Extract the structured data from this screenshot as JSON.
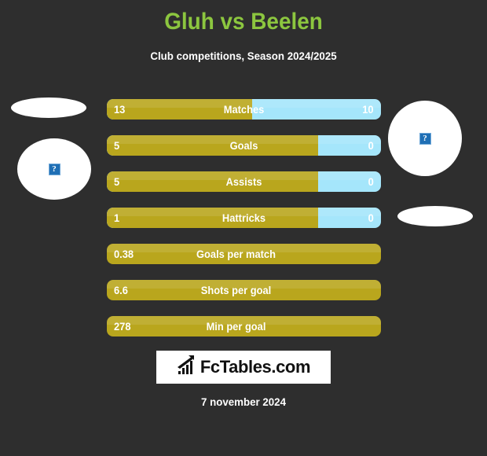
{
  "header": {
    "title": "Gluh vs Beelen",
    "subtitle": "Club competitions, Season 2024/2025",
    "title_color": "#8cc63f"
  },
  "placeholders": {
    "broken_image_glyph": "?",
    "left_top_name": "broken-image-ellipse",
    "left_bottom_name": "broken-image-circle",
    "right_top_name": "broken-image-circle",
    "right_bottom_name": "broken-image-ellipse"
  },
  "colors": {
    "background": "#2e2e2e",
    "home": "#b9a61d",
    "away": "#a5e6fb",
    "accent": "#8cc63f",
    "text": "#ffffff"
  },
  "chart_data": {
    "type": "bar",
    "title": "Gluh vs Beelen",
    "subtitle": "Club competitions, Season 2024/2025",
    "orientation": "horizontal-diverging",
    "series": [
      {
        "name": "Gluh",
        "color": "#b9a61d"
      },
      {
        "name": "Beelen",
        "color": "#a5e6fb"
      }
    ],
    "categories": [
      "Matches",
      "Goals",
      "Assists",
      "Hattricks",
      "Goals per match",
      "Shots per goal",
      "Min per goal"
    ],
    "rows": [
      {
        "label": "Matches",
        "left": "13",
        "right": "10",
        "left_pct": 53,
        "two_sided": true
      },
      {
        "label": "Goals",
        "left": "5",
        "right": "0",
        "left_pct": 77,
        "two_sided": true
      },
      {
        "label": "Assists",
        "left": "5",
        "right": "0",
        "left_pct": 77,
        "two_sided": true
      },
      {
        "label": "Hattricks",
        "left": "1",
        "right": "0",
        "left_pct": 77,
        "two_sided": true
      },
      {
        "label": "Goals per match",
        "left": "0.38",
        "right": "",
        "left_pct": 100,
        "two_sided": false
      },
      {
        "label": "Shots per goal",
        "left": "6.6",
        "right": "",
        "left_pct": 100,
        "two_sided": false
      },
      {
        "label": "Min per goal",
        "left": "278",
        "right": "",
        "left_pct": 100,
        "two_sided": false
      }
    ],
    "grid": false,
    "legend": "none"
  },
  "rows": {
    "r0": {
      "label": "Matches",
      "left": "13",
      "right": "10"
    },
    "r1": {
      "label": "Goals",
      "left": "5",
      "right": "0"
    },
    "r2": {
      "label": "Assists",
      "left": "5",
      "right": "0"
    },
    "r3": {
      "label": "Hattricks",
      "left": "1",
      "right": "0"
    },
    "r4": {
      "label": "Goals per match",
      "left": "0.38",
      "right": ""
    },
    "r5": {
      "label": "Shots per goal",
      "left": "6.6",
      "right": ""
    },
    "r6": {
      "label": "Min per goal",
      "left": "278",
      "right": ""
    }
  },
  "logo": {
    "text": "FcTables.com",
    "icon": "bar-chart-icon"
  },
  "footer": {
    "date": "7 november 2024"
  }
}
